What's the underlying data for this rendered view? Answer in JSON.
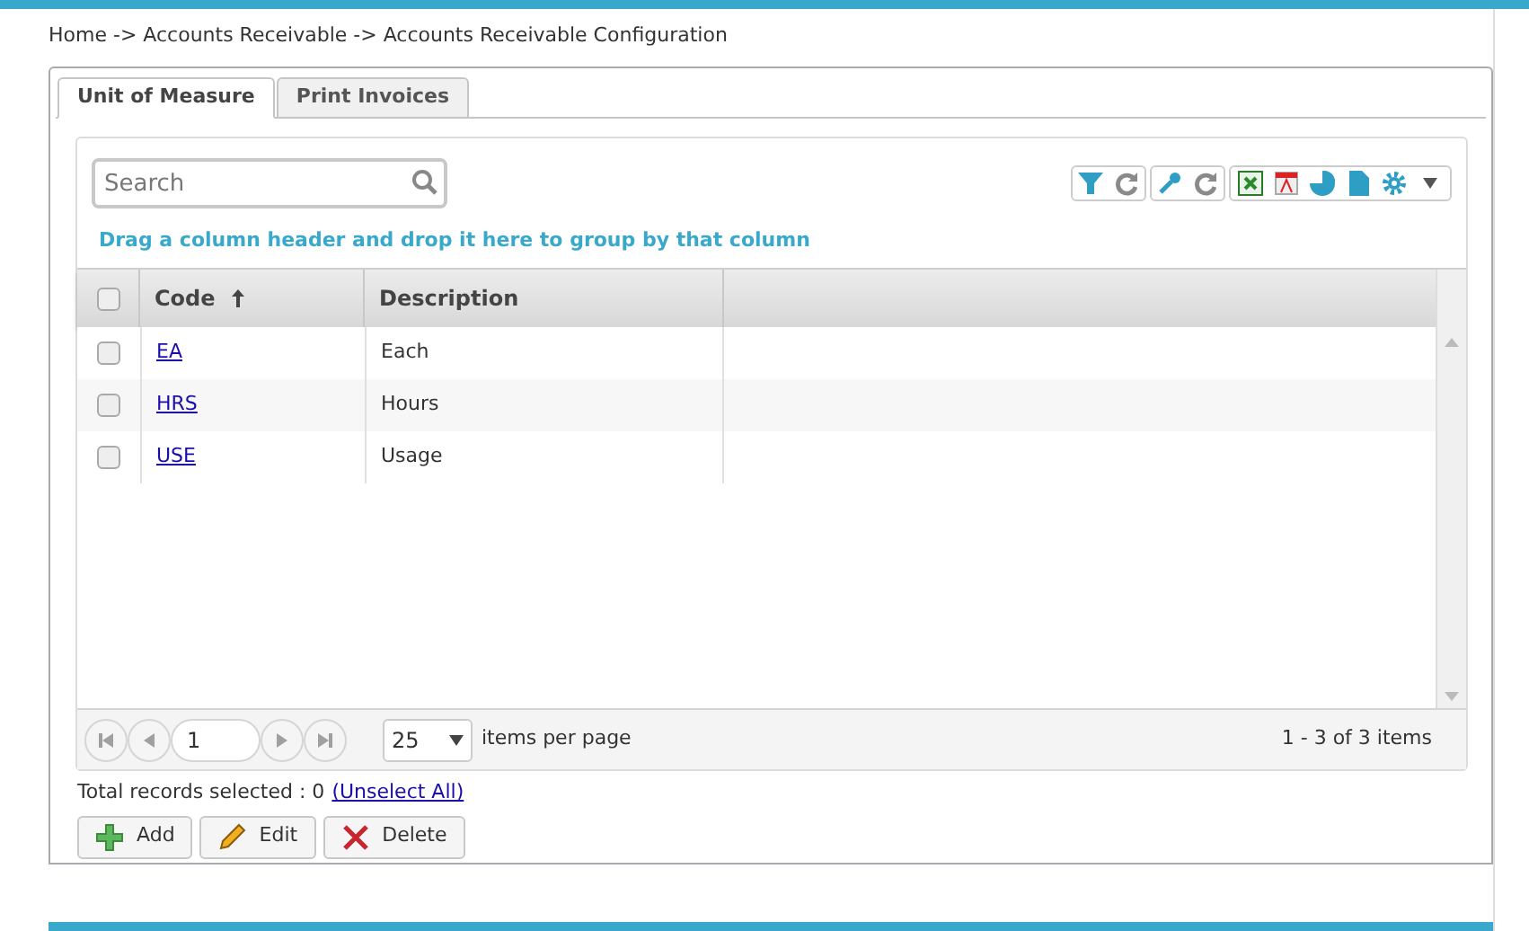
{
  "breadcrumb": "Home -> Accounts Receivable -> Accounts Receivable Configuration",
  "tabs": [
    {
      "label": "Unit of Measure",
      "selected": true
    },
    {
      "label": "Print Invoices",
      "selected": false
    }
  ],
  "search": {
    "placeholder": "Search"
  },
  "group_hint": "Drag a column header and drop it here to group by that column",
  "table": {
    "select_all": {
      "checked": false
    },
    "columns": [
      {
        "label": "Code",
        "sorted": true
      },
      {
        "label": "Description",
        "sorted": false
      }
    ],
    "rows": [
      {
        "code": "EA",
        "description": "Each",
        "checked": false
      },
      {
        "code": "HRS",
        "description": "Hours",
        "checked": false
      },
      {
        "code": "USE",
        "description": "Usage",
        "checked": false
      }
    ]
  },
  "pager": {
    "page": "1",
    "page_size": "25",
    "per_page_label": "items per page",
    "summary": "1 - 3 of 3 items"
  },
  "selection": {
    "label": "Total records selected : 0",
    "link": "(Unselect All)"
  },
  "buttons": [
    {
      "kind": "add",
      "label": "Add"
    },
    {
      "kind": "edit",
      "label": "Edit"
    },
    {
      "kind": "delete",
      "label": "Delete"
    }
  ]
}
